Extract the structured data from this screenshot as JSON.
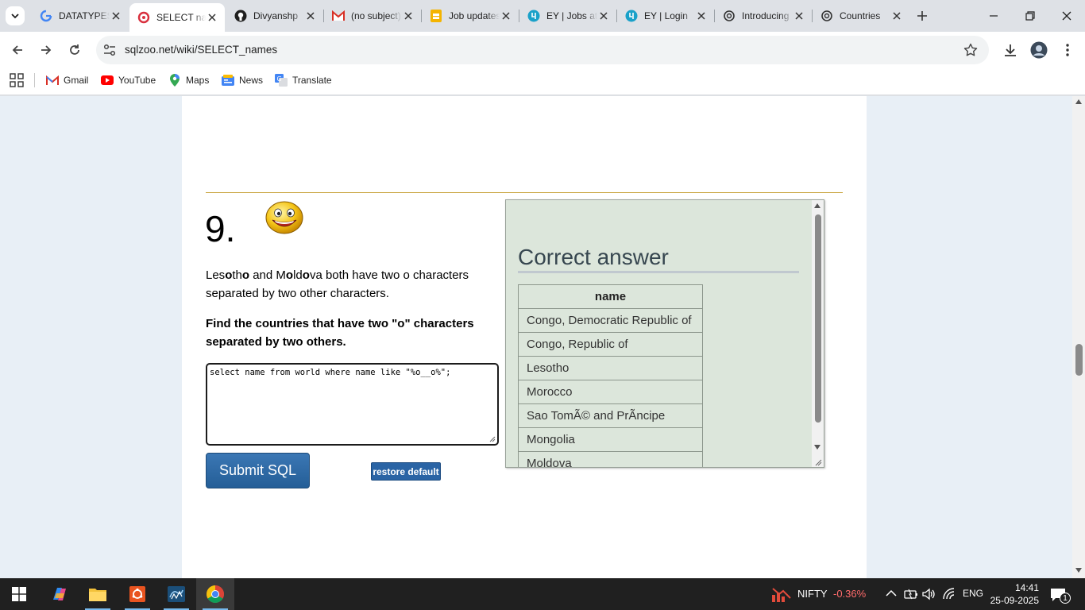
{
  "browser": {
    "tabs": [
      {
        "title": "DATATYPES",
        "icon": "google-icon",
        "active": false
      },
      {
        "title": "SELECT names",
        "icon": "sqlzoo-icon",
        "active": true
      },
      {
        "title": "Divyanshp",
        "icon": "github-icon",
        "active": false
      },
      {
        "title": "(no subject)",
        "icon": "gmail-icon",
        "active": false
      },
      {
        "title": "Job updates",
        "icon": "drive-doc-icon",
        "active": false
      },
      {
        "title": "EY | Jobs at",
        "icon": "ey-icon",
        "active": false
      },
      {
        "title": "EY | Login",
        "icon": "ey-icon",
        "active": false
      },
      {
        "title": "Introducing",
        "icon": "openai-icon",
        "active": false
      },
      {
        "title": "Countries",
        "icon": "openai-icon",
        "active": false
      }
    ],
    "url": "sqlzoo.net/wiki/SELECT_names",
    "bookmarks": [
      {
        "label": "Gmail",
        "icon": "gmail-icon"
      },
      {
        "label": "YouTube",
        "icon": "youtube-icon"
      },
      {
        "label": "Maps",
        "icon": "maps-icon"
      },
      {
        "label": "News",
        "icon": "news-icon"
      },
      {
        "label": "Translate",
        "icon": "translate-icon"
      }
    ]
  },
  "question": {
    "number": "9.",
    "intro_parts": [
      "Les",
      "o",
      "th",
      "o",
      " and M",
      "o",
      "ld",
      "o",
      "va both have two o characters separated by two other characters."
    ],
    "task": "Find the countries that have two \"o\" characters separated by two others.",
    "sql": "select name from world where name like \"%o__o%\";",
    "submit_label": "Submit SQL",
    "restore_label": "restore default"
  },
  "answer": {
    "heading": "Correct answer",
    "column": "name",
    "rows": [
      "Congo, Democratic Republic of",
      "Congo, Republic of",
      "Lesotho",
      "Morocco",
      "Sao TomÃ© and PrÃncipe",
      "Mongolia",
      "Moldova"
    ]
  },
  "taskbar": {
    "apps": [
      "start-icon",
      "copilot-icon",
      "file-explorer-icon",
      "ubuntu-icon",
      "mysql-workbench-icon",
      "chrome-icon"
    ],
    "market_name": "NIFTY",
    "market_change": "-0.36%",
    "language": "ENG",
    "time": "14:41",
    "date": "25-09-2025",
    "notification_count": "1"
  },
  "colors": {
    "accent_blue": "#2a64a5",
    "rule_gold": "#c9a640",
    "answer_bg": "#dce6db",
    "market_negative": "#ff6b6b"
  }
}
